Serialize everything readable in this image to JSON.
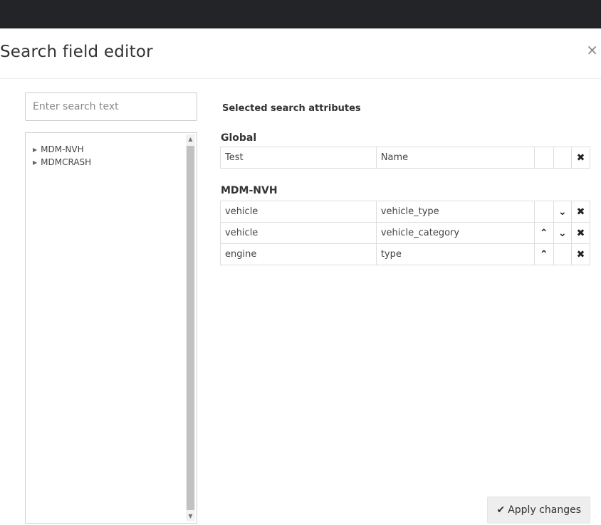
{
  "dialog": {
    "title": "Search field editor",
    "close_glyph": "×"
  },
  "search": {
    "placeholder": "Enter search text",
    "value": ""
  },
  "tree": {
    "items": [
      {
        "label": "MDM-NVH",
        "icon": "caret-right-icon",
        "caret_glyph": "▶"
      },
      {
        "label": "MDMCRASH",
        "icon": "caret-right-icon",
        "caret_glyph": "▶"
      }
    ],
    "scroll_up_glyph": "▲",
    "scroll_down_glyph": "▼"
  },
  "selected": {
    "heading": "Selected search attributes",
    "groups": [
      {
        "label": "Global",
        "rows": [
          {
            "type": "Test",
            "attribute": "Name",
            "up": "",
            "down": "",
            "remove": "✖"
          }
        ]
      },
      {
        "label": "MDM-NVH",
        "rows": [
          {
            "type": "vehicle",
            "attribute": "vehicle_type",
            "up": "",
            "down": "⌄",
            "remove": "✖"
          },
          {
            "type": "vehicle",
            "attribute": "vehicle_category",
            "up": "⌃",
            "down": "⌄",
            "remove": "✖"
          },
          {
            "type": "engine",
            "attribute": "type",
            "up": "⌃",
            "down": "",
            "remove": "✖"
          }
        ]
      }
    ]
  },
  "footer": {
    "apply_label": "Apply changes",
    "apply_icon": "✔"
  },
  "colors": {
    "topbar": "#222427",
    "button_bg": "#eeeeee",
    "border": "#dddddd"
  }
}
